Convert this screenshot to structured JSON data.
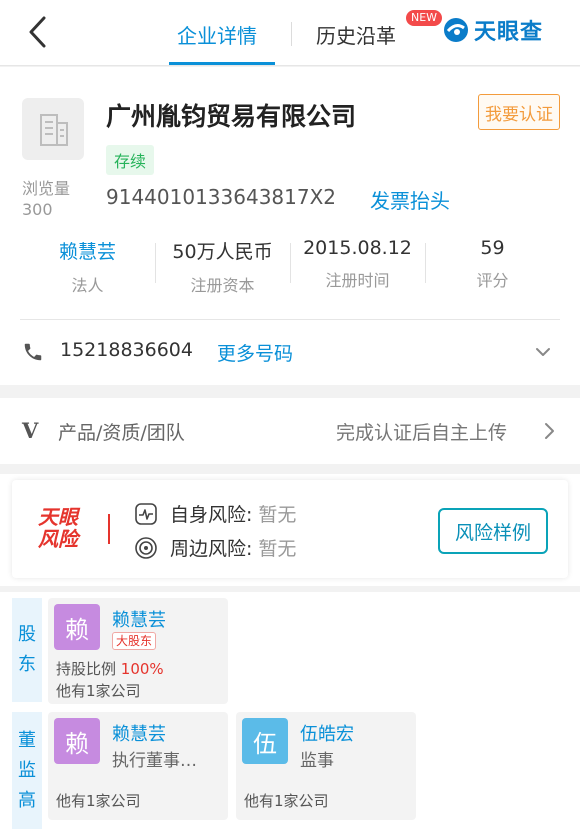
{
  "header": {
    "tab_active": "企业详情",
    "tab_2": "历史沿革",
    "new_badge": "NEW",
    "logo_text": "天眼查"
  },
  "company": {
    "name": "广州胤钧贸易有限公司",
    "status": "存续",
    "credit_code": "9144010133643817X2",
    "invoice_link": "发票抬头",
    "verify_button": "我要认证",
    "views_label": "浏览量",
    "views_value": "300",
    "stats": [
      {
        "value": "赖慧芸",
        "label": "法人"
      },
      {
        "value": "50万人民币",
        "label": "注册资本"
      },
      {
        "value": "2015.08.12",
        "label": "注册时间"
      },
      {
        "value": "59",
        "label": "评分"
      }
    ],
    "phone": "15218836604",
    "more_phones": "更多号码"
  },
  "product": {
    "icon_letter": "V",
    "label": "产品/资质/团队",
    "right_text": "完成认证后自主上传"
  },
  "risk": {
    "logo_line1": "天眼",
    "logo_line2": "风险",
    "self_label": "自身风险:",
    "self_value": "暂无",
    "nearby_label": "周边风险:",
    "nearby_value": "暂无",
    "sample_button": "风险样例"
  },
  "shareholders": {
    "side_label": [
      "股",
      "东"
    ],
    "items": [
      {
        "avatar_char": "赖",
        "name": "赖慧芸",
        "tag": "大股东",
        "ratio_label": "持股比例",
        "ratio_value": "100%",
        "companies": "他有1家公司"
      }
    ]
  },
  "executives": {
    "side_label": [
      "董",
      "监",
      "高"
    ],
    "items": [
      {
        "avatar_char": "赖",
        "name": "赖慧芸",
        "role": "执行董事…",
        "companies": "他有1家公司"
      },
      {
        "avatar_char": "伍",
        "name": "伍皓宏",
        "role": "监事",
        "companies": "他有1家公司"
      }
    ]
  },
  "colors": {
    "accent": "#0a90d8",
    "status_green": "#26b35a",
    "risk_red": "#e5342d",
    "verify_orange": "#f39b3c",
    "avatar_purple": "#c68be0",
    "avatar_blue": "#5bbbe8"
  },
  "icons": [
    "back-chevron-icon",
    "company-building-icon",
    "phone-icon",
    "chevron-down-icon",
    "chevron-right-icon",
    "heartbeat-icon",
    "radar-icon"
  ]
}
